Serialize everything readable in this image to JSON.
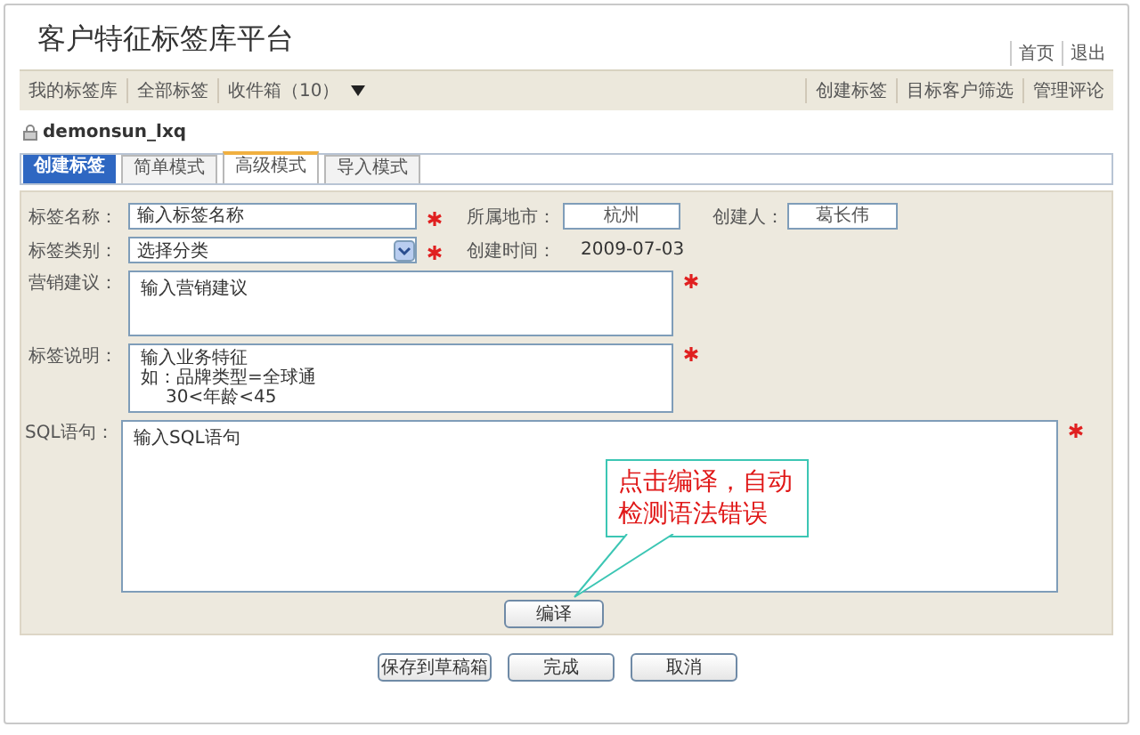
{
  "header": {
    "title": "客户特征标签库平台",
    "links": [
      "首页",
      "退出"
    ]
  },
  "nav": {
    "left": [
      {
        "label": "我的标签库",
        "kind": "link"
      },
      {
        "label": "全部标签",
        "kind": "link"
      },
      {
        "label": "收件箱（10）",
        "kind": "menu"
      }
    ],
    "right": [
      "创建标签",
      "目标客户筛选",
      "管理评论"
    ]
  },
  "user": "demonsun_lxq",
  "section_label": "创建标签",
  "tabs": [
    {
      "label": "简单模式",
      "selected": false
    },
    {
      "label": "高级模式",
      "selected": true
    },
    {
      "label": "导入模式",
      "selected": false
    }
  ],
  "form": {
    "name": {
      "label": "标签名称：",
      "placeholder": "输入标签名称",
      "required": true
    },
    "category": {
      "label": "标签类别：",
      "value": "选择分类",
      "required": true
    },
    "city": {
      "label": "所属地市：",
      "value": "杭州"
    },
    "creator": {
      "label": "创建人：",
      "value": "葛长伟"
    },
    "created": {
      "label": "创建时间：",
      "value": "2009-07-03"
    },
    "marketing": {
      "label": "营销建议：",
      "placeholder": "输入营销建议",
      "required": true
    },
    "description": {
      "label": "标签说明：",
      "lines": [
        {
          "text": "输入业务特征",
          "indent": false
        },
        {
          "text": "如：品牌类型=全球通",
          "indent": false
        },
        {
          "text": "30<年龄<45",
          "indent": true
        }
      ],
      "required": true
    },
    "sql": {
      "label": "SQL语句：",
      "placeholder": "输入SQL语句",
      "required": true
    },
    "compile_button": "编译"
  },
  "callout": "点击编译，自动检测语法错误",
  "buttons": [
    "保存到草稿箱",
    "完成",
    "取消"
  ]
}
